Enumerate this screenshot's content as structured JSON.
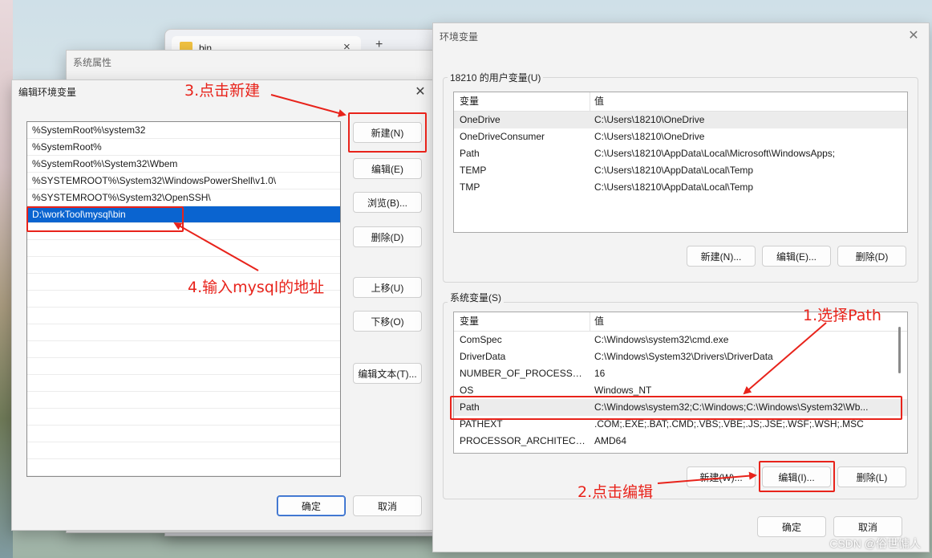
{
  "bg_explorer": {
    "tab_title": "bin",
    "tab_close": "×",
    "new_tab": "+"
  },
  "bg_sysprops": {
    "title": "系统属性"
  },
  "edit_dialog": {
    "title": "编辑环境变量",
    "close": "✕",
    "entries": [
      "%SystemRoot%\\system32",
      "%SystemRoot%",
      "%SystemRoot%\\System32\\Wbem",
      "%SYSTEMROOT%\\System32\\WindowsPowerShell\\v1.0\\",
      "%SYSTEMROOT%\\System32\\OpenSSH\\",
      "D:\\workTool\\mysql\\bin"
    ],
    "buttons": {
      "new": "新建(N)",
      "edit": "编辑(E)",
      "browse": "浏览(B)...",
      "delete": "删除(D)",
      "move_up": "上移(U)",
      "move_down": "下移(O)",
      "edit_text": "编辑文本(T)...",
      "ok": "确定",
      "cancel": "取消"
    }
  },
  "env_dialog": {
    "title": "环境变量",
    "close": "✕",
    "user_group_label": "18210 的用户变量(U)",
    "sys_group_label": "系统变量(S)",
    "col_var": "变量",
    "col_val": "值",
    "user_vars": [
      {
        "name": "OneDrive",
        "value": "C:\\Users\\18210\\OneDrive"
      },
      {
        "name": "OneDriveConsumer",
        "value": "C:\\Users\\18210\\OneDrive"
      },
      {
        "name": "Path",
        "value": "C:\\Users\\18210\\AppData\\Local\\Microsoft\\WindowsApps;"
      },
      {
        "name": "TEMP",
        "value": "C:\\Users\\18210\\AppData\\Local\\Temp"
      },
      {
        "name": "TMP",
        "value": "C:\\Users\\18210\\AppData\\Local\\Temp"
      }
    ],
    "sys_vars": [
      {
        "name": "ComSpec",
        "value": "C:\\Windows\\system32\\cmd.exe"
      },
      {
        "name": "DriverData",
        "value": "C:\\Windows\\System32\\Drivers\\DriverData"
      },
      {
        "name": "NUMBER_OF_PROCESSORS",
        "value": "16"
      },
      {
        "name": "OS",
        "value": "Windows_NT"
      },
      {
        "name": "Path",
        "value": "C:\\Windows\\system32;C:\\Windows;C:\\Windows\\System32\\Wb..."
      },
      {
        "name": "PATHEXT",
        "value": ".COM;.EXE;.BAT;.CMD;.VBS;.VBE;.JS;.JSE;.WSF;.WSH;.MSC"
      },
      {
        "name": "PROCESSOR_ARCHITECT...",
        "value": "AMD64"
      }
    ],
    "user_buttons": {
      "new": "新建(N)...",
      "edit": "编辑(E)...",
      "delete": "删除(D)"
    },
    "sys_buttons": {
      "new": "新建(W)...",
      "edit": "编辑(I)...",
      "delete": "删除(L)"
    },
    "ok": "确定",
    "cancel": "取消"
  },
  "annotations": {
    "step1": "1.选择Path",
    "step2": "2.点击编辑",
    "step3": "3.点击新建",
    "step4": "4.输入mysql的地址",
    "color": "#e8231b"
  },
  "watermark": "CSDN @俗世慵人"
}
